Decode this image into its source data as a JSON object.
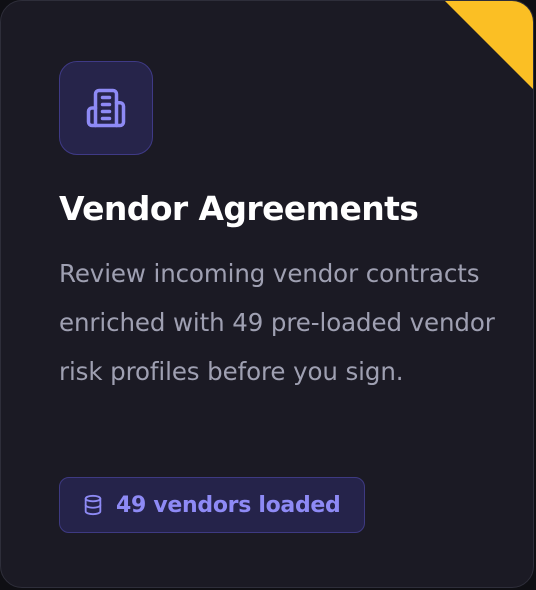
{
  "card": {
    "title": "Vendor Agreements",
    "description": "Review incoming vendor contracts enriched with 49 pre-loaded vendor risk profiles before you sign.",
    "badge_label": "49 vendors loaded",
    "icon": "building-icon",
    "badge_icon": "database-icon"
  },
  "colors": {
    "card_background": "#1b1a24",
    "accent": "#8e8af5",
    "corner_ribbon": "#fbbf24"
  }
}
